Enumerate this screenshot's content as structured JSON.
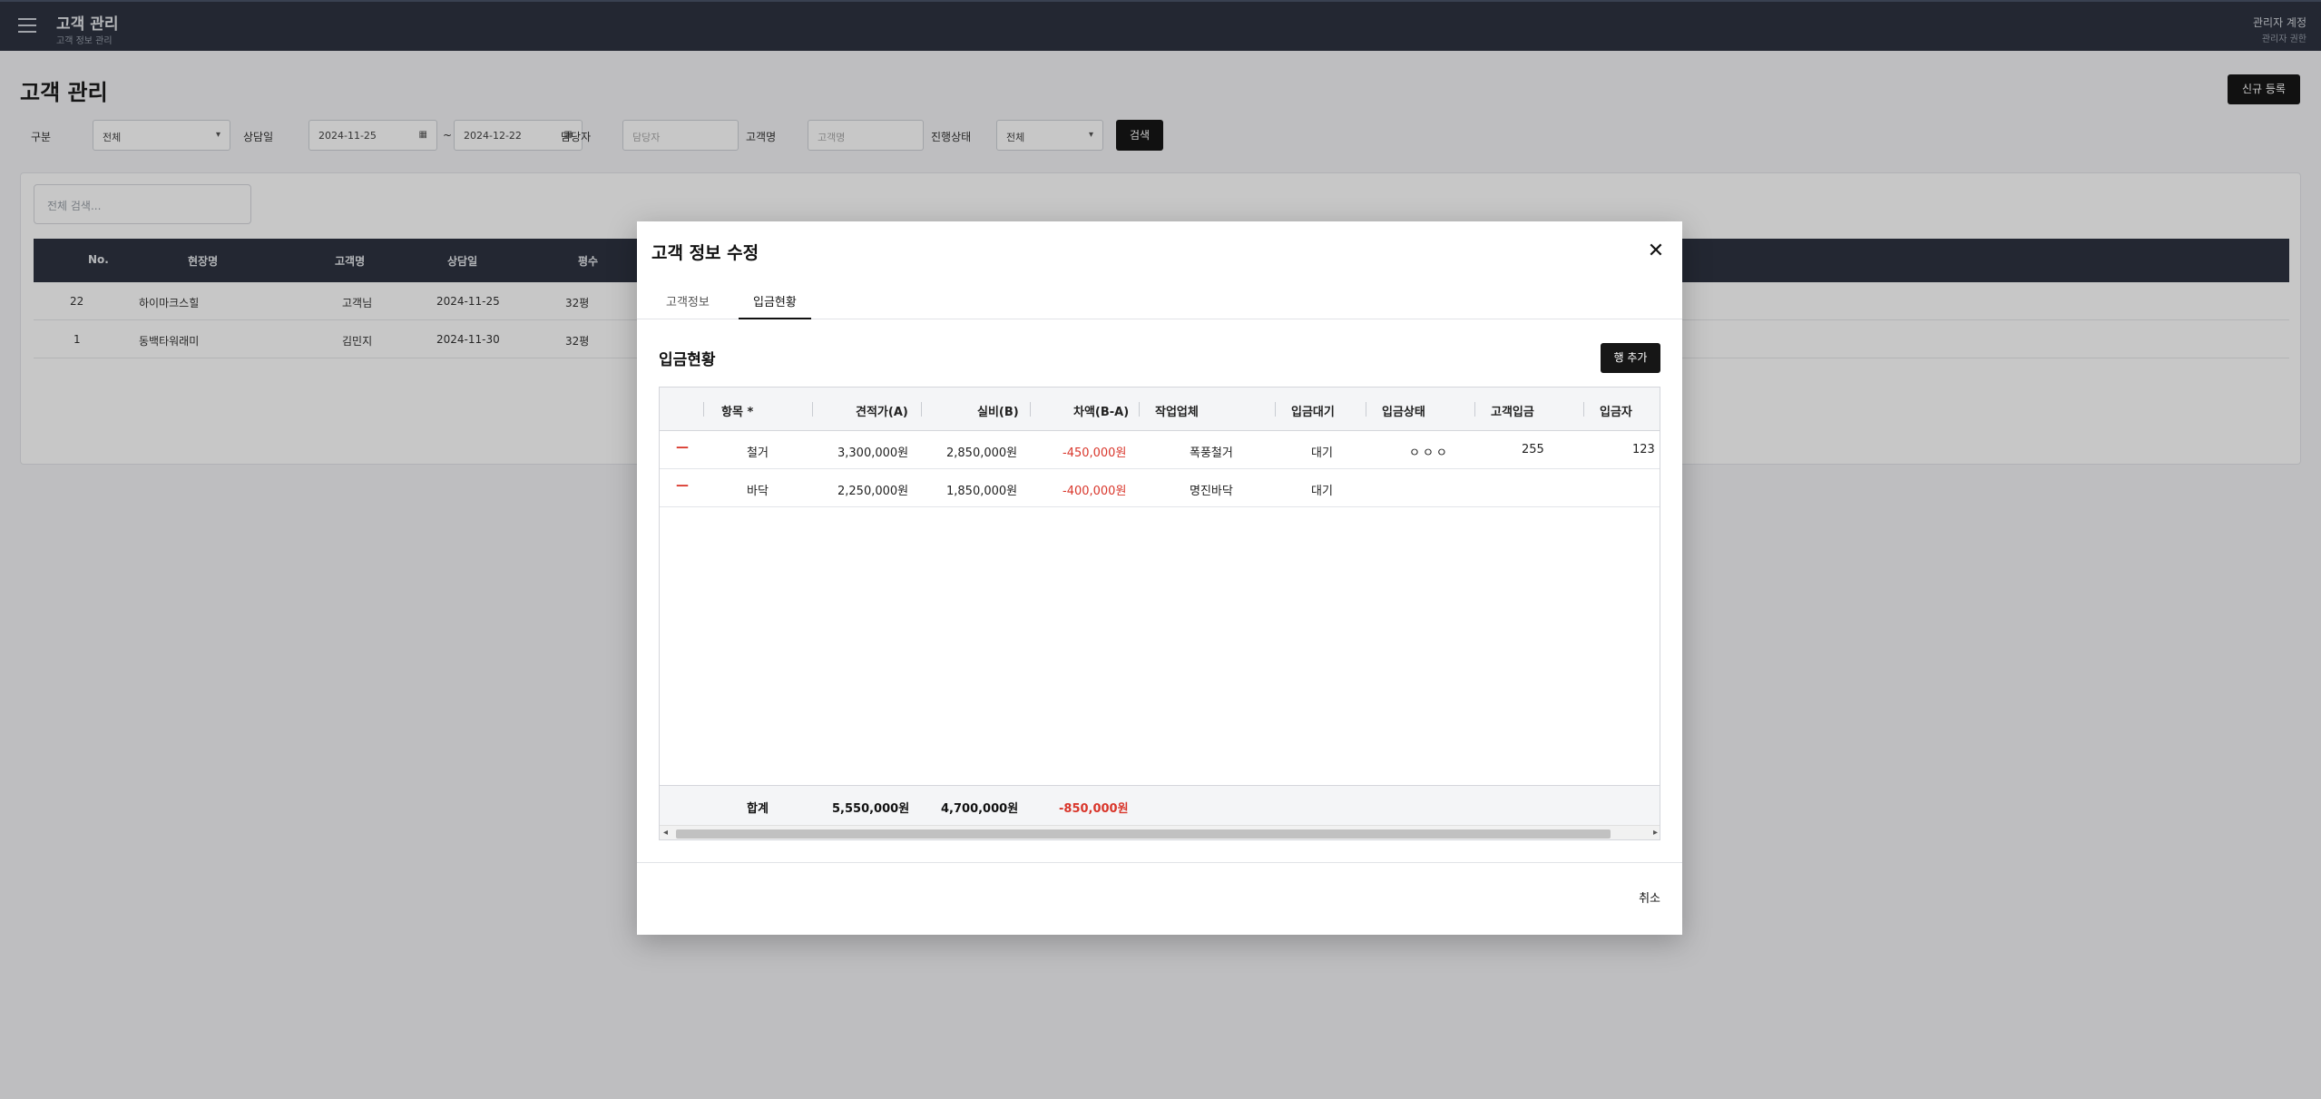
{
  "app": {
    "title": "고객 관리",
    "subtitle": "고객 정보 관리",
    "user_name": "관리자 계정",
    "user_role": "관리자 권한"
  },
  "page": {
    "title": "고객 관리",
    "new_button": "신규 등록"
  },
  "filters": {
    "type_label": "구분",
    "type_value": "전체",
    "date_label": "상담일",
    "date_from": "2024-11-25",
    "date_to": "2024-12-22",
    "manager_label": "담당자",
    "manager_placeholder": "담당자",
    "customer_label": "고객명",
    "customer_placeholder": "고객명",
    "contract_label": "진행상태",
    "contract_value": "전체",
    "search_button": "검색"
  },
  "list": {
    "search_placeholder": "전체 검색...",
    "columns": [
      "No.",
      "현장명",
      "고객명",
      "상담일",
      "평수"
    ],
    "rows": [
      [
        "22",
        "하이마크스힐",
        "고객님",
        "2024-11-25",
        "32평"
      ],
      [
        "1",
        "동백타워래미",
        "김민지",
        "2024-11-30",
        "32평"
      ]
    ]
  },
  "modal": {
    "title": "고객 정보 수정",
    "tabs": [
      {
        "label": "고객정보",
        "active": false
      },
      {
        "label": "입금현황",
        "active": true
      }
    ],
    "section_title": "입금현황",
    "add_row_button": "행 추가",
    "cancel_button": "취소",
    "columns": [
      "항목 *",
      "견적가(A)",
      "실비(B)",
      "차액(B-A)",
      "작업업체",
      "입금대기",
      "입금상태",
      "고객입금",
      "입금자"
    ],
    "rows": [
      {
        "item": "철거",
        "estimate": "3,300,000원",
        "actual": "2,850,000원",
        "diff": "-450,000원",
        "vendor": "폭풍철거",
        "pending": "대기",
        "status": "ㅇㅇㅇ",
        "customer_deposit": "255",
        "depositor": "123"
      },
      {
        "item": "바닥",
        "estimate": "2,250,000원",
        "actual": "1,850,000원",
        "diff": "-400,000원",
        "vendor": "명진바닥",
        "pending": "대기",
        "status": "",
        "customer_deposit": "",
        "depositor": ""
      }
    ],
    "footer": {
      "label": "합계",
      "estimate": "5,550,000원",
      "actual": "4,700,000원",
      "diff": "-850,000원"
    },
    "delete_glyph": "—",
    "close_glyph": "✕"
  },
  "colors": {
    "accent_dark": "#161616",
    "negative": "#d9362b",
    "topbar": "#2d3340"
  }
}
